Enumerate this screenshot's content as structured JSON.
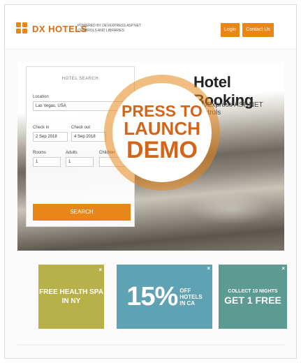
{
  "header": {
    "logo": "DX HOTELS",
    "tagline": "POWERED BY DEVEXPRESS ASP.NET CONTROLS AND LIBRARIES",
    "login_label": "Login",
    "contact_label": "Contact Us"
  },
  "hero": {
    "title": "Hotel Booking",
    "subtitle": "DevExpress ASP.NET Controls"
  },
  "search": {
    "title": "HOTEL SEARCH",
    "location_label": "Location",
    "location_value": "Las Vegas, USA",
    "checkin_label": "Check in",
    "checkin_value": "2 Sep 2018",
    "checkout_label": "Check out",
    "checkout_value": "4 Sep 2018",
    "rooms_label": "Rooms",
    "rooms_value": "1",
    "adults_label": "Adults",
    "adults_value": "1",
    "children_label": "Children",
    "button_label": "SEARCH"
  },
  "demo": {
    "line1": "PRESS TO",
    "line2": "LAUNCH",
    "line3": "DEMO"
  },
  "promos": {
    "spa": "FREE HEALTH SPA IN NY",
    "percent": "15%",
    "percent_side1": "OFF",
    "percent_side2": "HOTELS",
    "percent_side3": "IN CA",
    "free_top": "COLLECT 10 NIGHTS",
    "free_main": "GET 1 FREE",
    "close": "×"
  },
  "colors": {
    "accent": "#e8861a",
    "spa": "#b8b14a",
    "percent": "#5ea2b3",
    "free": "#5c9a92"
  }
}
